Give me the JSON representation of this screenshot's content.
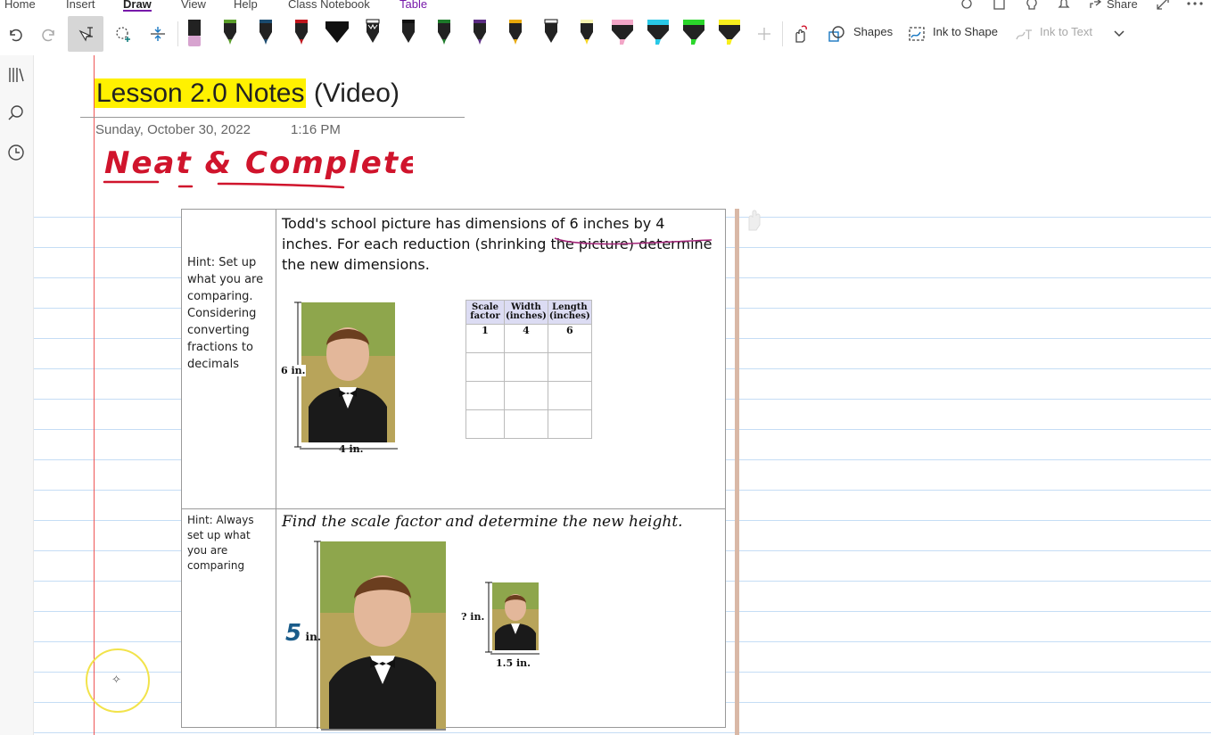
{
  "tabs": [
    {
      "label": "Home"
    },
    {
      "label": "Insert"
    },
    {
      "label": "Draw"
    },
    {
      "label": "View"
    },
    {
      "label": "Help"
    },
    {
      "label": "Class Notebook"
    },
    {
      "label": "Table"
    }
  ],
  "top_right": {
    "share_label": "Share"
  },
  "ribbon": {
    "shapes_label": "Shapes",
    "ink_to_shape_label": "Ink to Shape",
    "ink_to_text_label": "Ink to Text",
    "pens": [
      "#222222",
      "#5a9e2a",
      "#1a4a6e",
      "#c0161d",
      "#111111",
      "#111111",
      "#111111",
      "#1d7a2a",
      "#5b2c83",
      "#e8a90a",
      "#111111",
      "#f7d51d",
      "#f2a6c7",
      "#29c8e6",
      "#2bd62b",
      "#f7ee1d"
    ]
  },
  "page": {
    "title_highlighted": "Lesson 2.0 Notes",
    "title_rest": " (Video)",
    "date": "Sunday, October 30, 2022",
    "time": "1:16 PM",
    "ink_note": "Neat & Complete!!"
  },
  "table": {
    "row1": {
      "hint": "Hint: Set up what you are comparing. Considering converting fractions to decimals",
      "problem": "Todd's school picture has dimensions of 6 inches by 4 inches. For each reduction (shrinking the picture) determine the new dimensions.",
      "height_label": "6 in.",
      "width_label": "4 in.",
      "sf_table": {
        "headers": [
          "Scale factor",
          "Width (inches)",
          "Length (inches)"
        ],
        "rows": [
          [
            "1",
            "4",
            "6"
          ],
          [
            "",
            "",
            ""
          ],
          [
            "",
            "",
            ""
          ],
          [
            "",
            "",
            ""
          ]
        ]
      }
    },
    "row2": {
      "hint": "Hint: Always set up what you are comparing",
      "problem": "Find the scale factor and determine the new height.",
      "big_height_digit": "5",
      "big_height_unit": "in.",
      "small_height_label": "? in.",
      "small_width_label": "1.5 in."
    }
  },
  "colors": {
    "accent": "#7719aa",
    "highlight": "#fff100",
    "ink_red": "#d0142c",
    "ink_blue": "#1a5c8a",
    "rule": "#c5ddf5",
    "margin": "#ee5555"
  }
}
